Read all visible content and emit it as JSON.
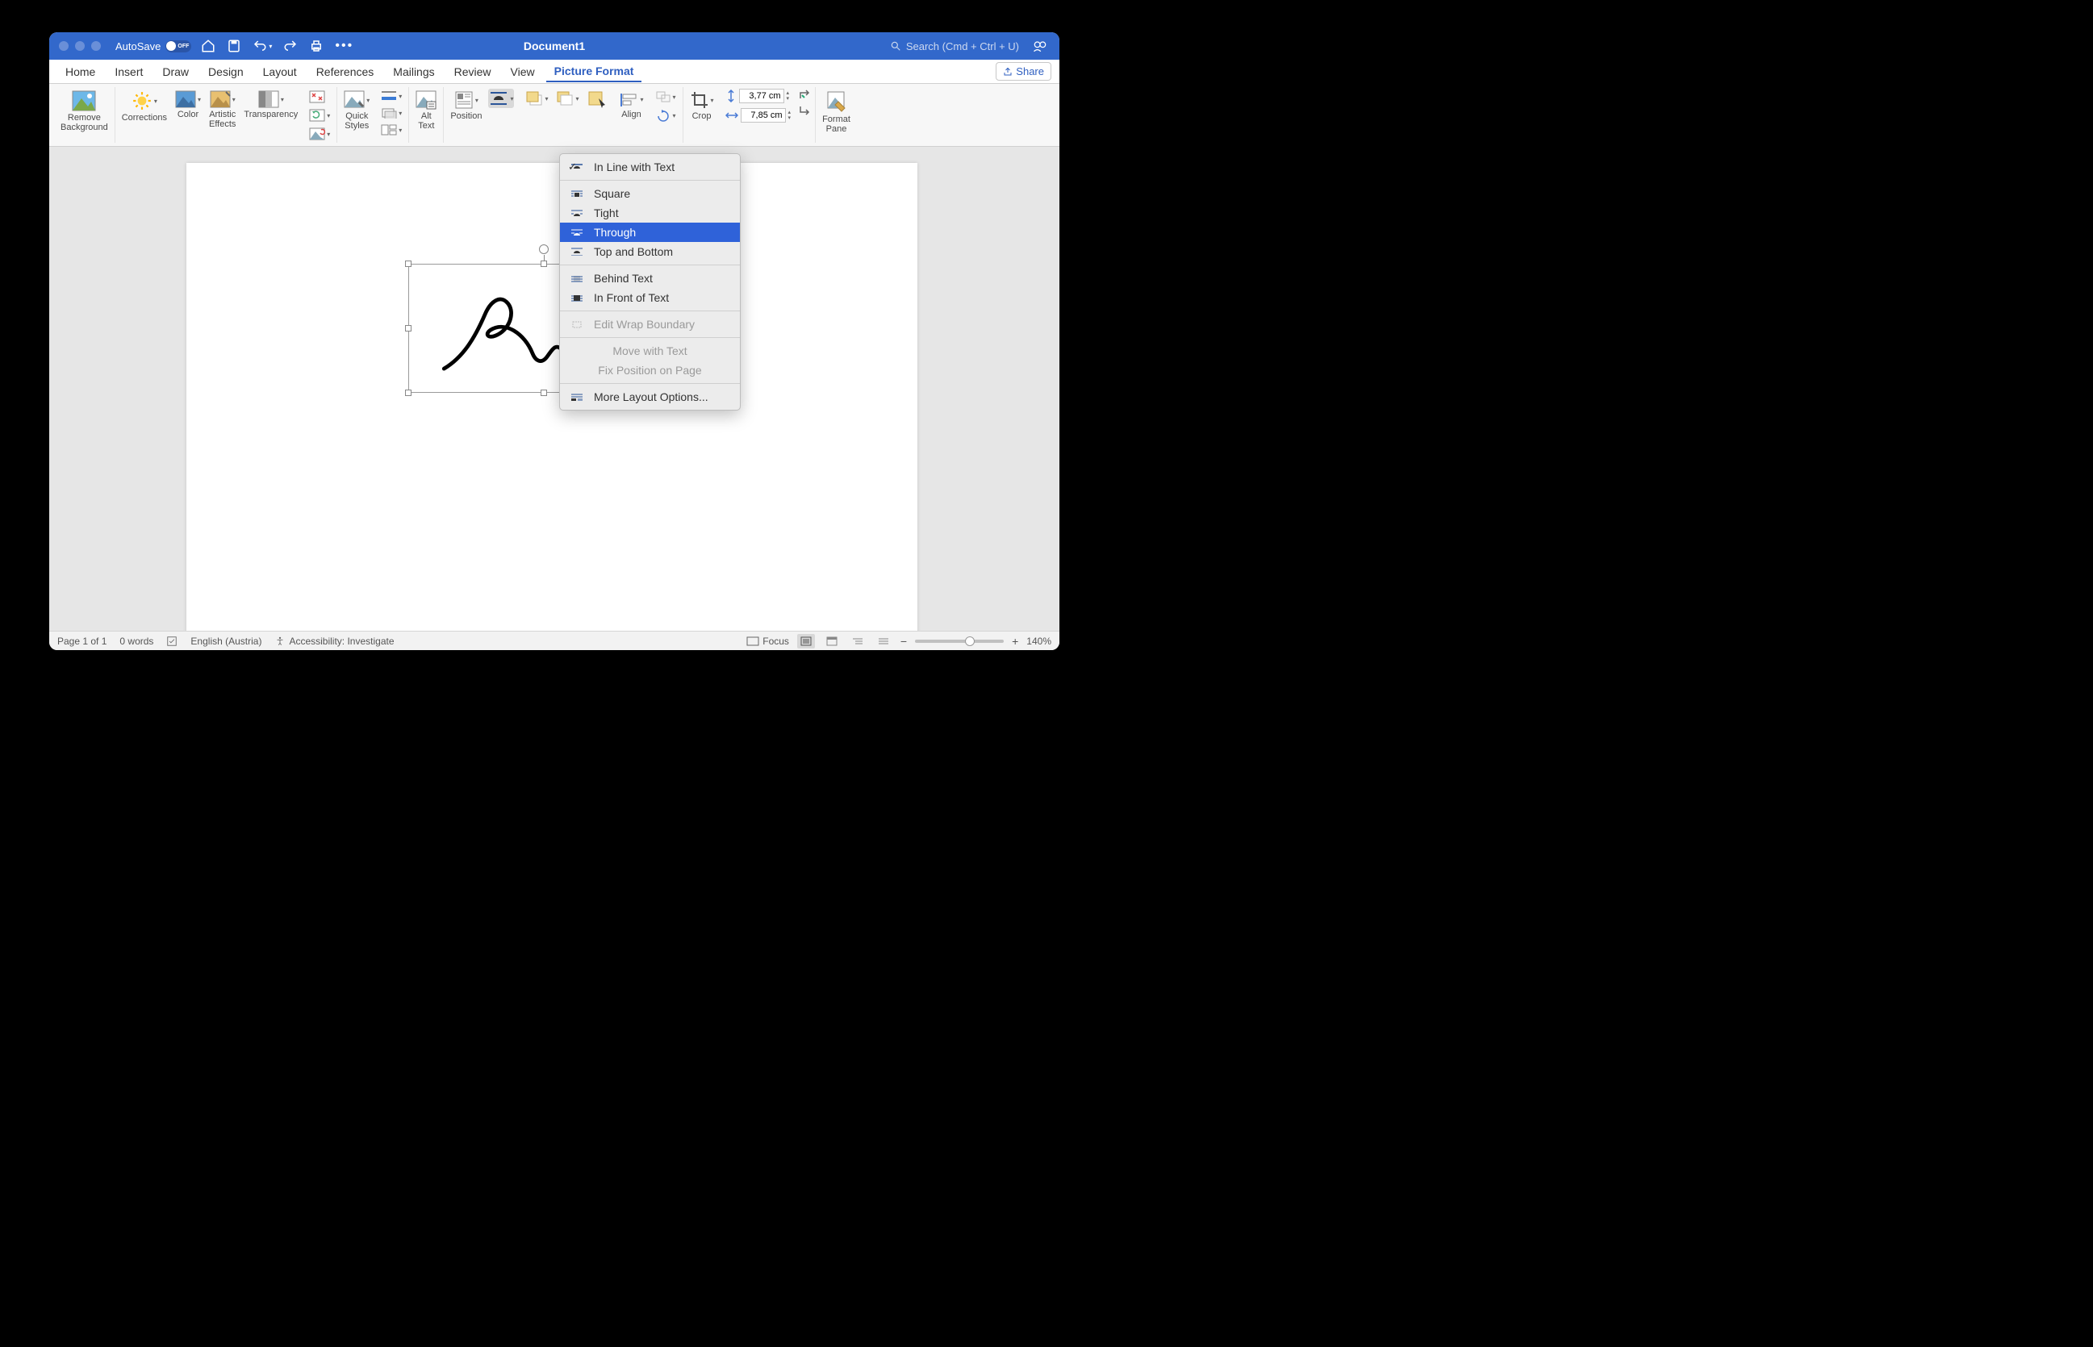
{
  "titlebar": {
    "autosave_label": "AutoSave",
    "autosave_state": "OFF",
    "document_title": "Document1",
    "search_placeholder": "Search (Cmd + Ctrl + U)"
  },
  "tabs": {
    "items": [
      "Home",
      "Insert",
      "Draw",
      "Design",
      "Layout",
      "References",
      "Mailings",
      "Review",
      "View",
      "Picture Format"
    ],
    "active": "Picture Format",
    "share": "Share"
  },
  "ribbon": {
    "remove_bg": "Remove\nBackground",
    "corrections": "Corrections",
    "color": "Color",
    "artistic": "Artistic\nEffects",
    "transparency": "Transparency",
    "quick_styles": "Quick\nStyles",
    "alt_text": "Alt\nText",
    "position": "Position",
    "align": "Align",
    "crop": "Crop",
    "format_pane": "Format\nPane",
    "height": "3,77 cm",
    "width": "7,85 cm"
  },
  "dropdown": {
    "in_line": "In Line with Text",
    "square": "Square",
    "tight": "Tight",
    "through": "Through",
    "top_bottom": "Top and Bottom",
    "behind": "Behind Text",
    "front": "In Front of Text",
    "edit_boundary": "Edit Wrap Boundary",
    "move_with": "Move with Text",
    "fix_position": "Fix Position on Page",
    "more": "More Layout Options..."
  },
  "statusbar": {
    "page": "Page 1 of 1",
    "words": "0 words",
    "language": "English (Austria)",
    "accessibility": "Accessibility: Investigate",
    "focus": "Focus",
    "zoom": "140%"
  }
}
